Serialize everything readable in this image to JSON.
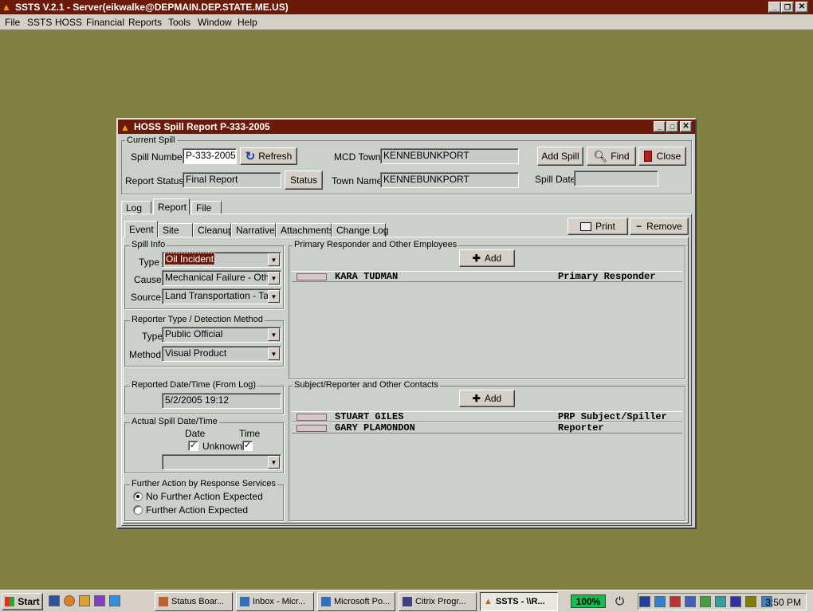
{
  "app": {
    "title": "SSTS V.2.1 - Server(eikwalke@DEPMAIN.DEP.STATE.ME.US)",
    "menu": [
      "File",
      "SSTS",
      "HOSS",
      "Financial",
      "Reports",
      "Tools",
      "Window",
      "Help"
    ]
  },
  "dialog": {
    "title": "HOSS Spill Report P-333-2005",
    "current_spill": {
      "group_label": "Current Spill",
      "spill_number_label": "Spill Number",
      "spill_number": "P-333-2005",
      "refresh_label": "Refresh",
      "report_status_label": "Report Status",
      "report_status": "Final Report",
      "status_button": "Status",
      "mcd_town_label": "MCD Town",
      "mcd_town": "KENNEBUNKPORT",
      "town_name_label": "Town Name",
      "town_name": "KENNEBUNKPORT",
      "add_spill_label": "Add Spill",
      "find_label": "Find",
      "close_label": "Close",
      "spill_date_label": "Spill Date",
      "spill_date": ""
    },
    "main_tabs": [
      "Log",
      "Report",
      "File"
    ],
    "sub_tabs": [
      "Event",
      "Site",
      "Cleanup",
      "Narrative",
      "Attachments",
      "Change Log"
    ],
    "print_label": "Print",
    "remove_label": "Remove",
    "spill_info": {
      "group_label": "Spill Info",
      "type_label": "Type",
      "type": "Oil Incident",
      "cause_label": "Cause",
      "cause": "Mechanical Failure - Other",
      "source_label": "Source",
      "source": "Land Transportation - Tank"
    },
    "reporter": {
      "group_label": "Reporter Type / Detection Method",
      "type_label": "Type",
      "type": "Public Official",
      "method_label": "Method",
      "method": "Visual Product"
    },
    "reported": {
      "group_label": "Reported Date/Time (From Log)",
      "value": "5/2/2005 19:12"
    },
    "actual": {
      "group_label": "Actual Spill Date/Time",
      "date_label": "Date",
      "time_label": "Time",
      "unknown_label": "Unknown",
      "date_unknown": true,
      "time_unknown": true,
      "value": ""
    },
    "further": {
      "group_label": "Further Action by Response Services",
      "option1": "No Further Action Expected",
      "option2": "Further Action Expected",
      "selected": 1
    },
    "primary": {
      "group_label": "Primary Responder and Other Employees",
      "add_label": "Add",
      "rows": [
        {
          "name": "KARA TUDMAN",
          "role": "Primary Responder"
        }
      ]
    },
    "subject": {
      "group_label": "Subject/Reporter and Other Contacts",
      "add_label": "Add",
      "rows": [
        {
          "name": "STUART GILES",
          "role": "PRP Subject/Spiller"
        },
        {
          "name": "GARY PLAMONDON",
          "role": "Reporter"
        }
      ]
    }
  },
  "taskbar": {
    "start": "Start",
    "items": [
      "Status Boar...",
      "Inbox - Micr...",
      "Microsoft Po...",
      "Citrix Progr...",
      "SSTS - \\\\R..."
    ],
    "zoom": "100%",
    "clock": "3:50 PM"
  },
  "colors": {
    "desktop": "#808040",
    "titlebar": "#6b1a0a",
    "dialog_bg": "#cbd0cb",
    "selected_combo": "#6b1a0a"
  }
}
